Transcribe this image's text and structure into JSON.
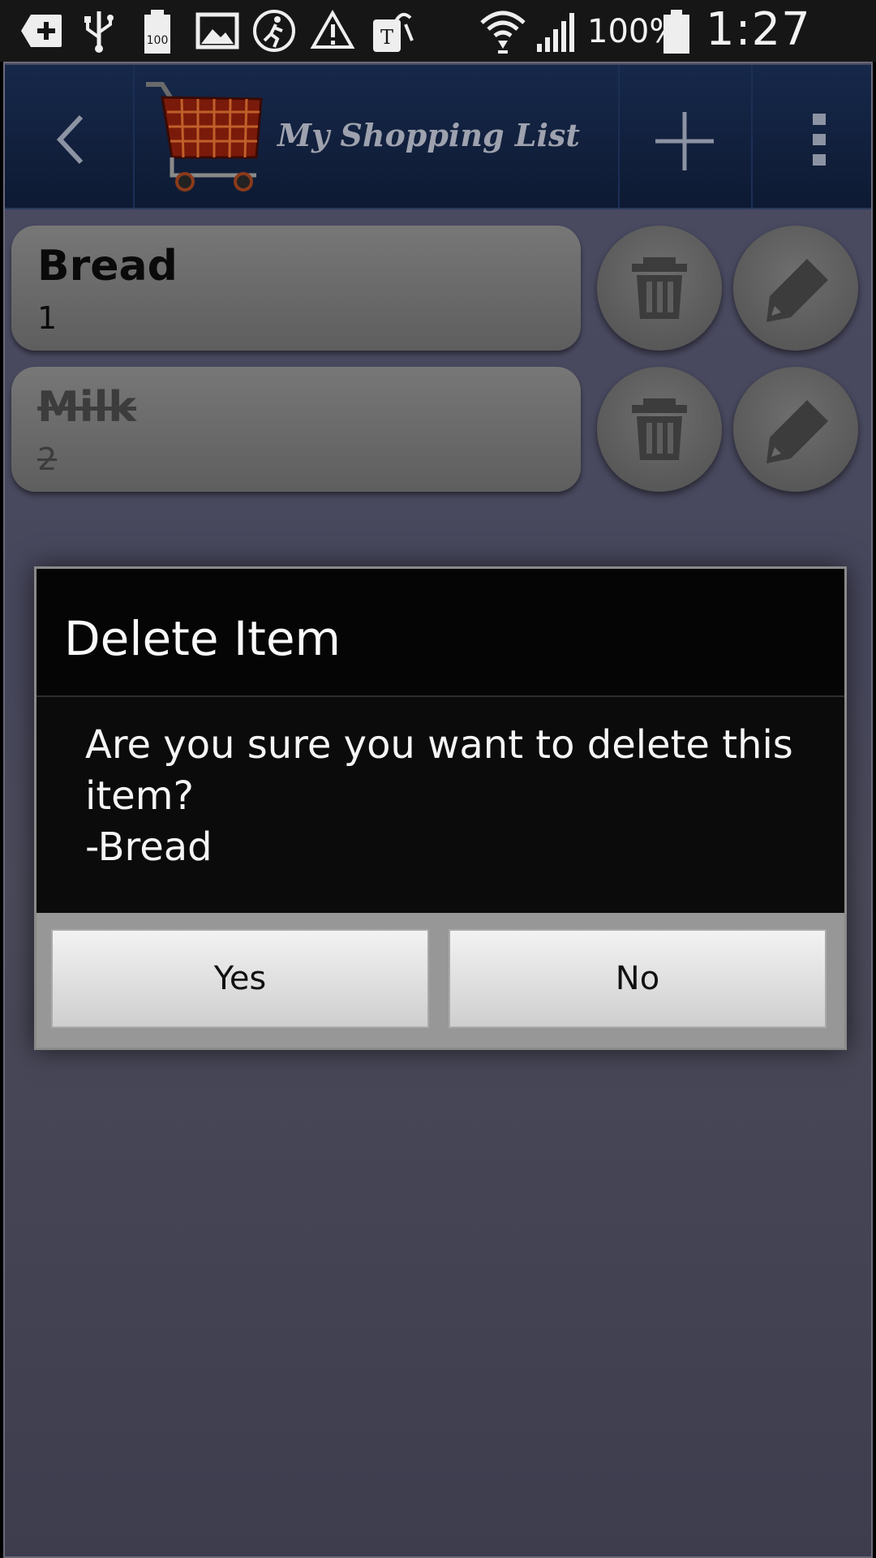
{
  "status_bar": {
    "icons": [
      "add-box-icon",
      "usb-icon",
      "battery-100-icon",
      "image-icon",
      "running-icon",
      "warning-icon",
      "t-mobile-icon",
      "wifi-icon",
      "signal-icon",
      "battery-icon"
    ],
    "battery_text": "100%",
    "time": "1:27 AM"
  },
  "action_bar": {
    "title": "My Shopping List",
    "icons": [
      "back-chevron-icon",
      "shopping-cart-logo",
      "add-icon",
      "overflow-menu-icon"
    ]
  },
  "items": [
    {
      "name": "Bread",
      "qty": "1",
      "crossed": false
    },
    {
      "name": "Milk",
      "qty": "2",
      "crossed": true
    }
  ],
  "dialog": {
    "title": "Delete Item",
    "message_line1": "Are you sure you want to delete this item?",
    "message_line2": "-Bread",
    "yes": "Yes",
    "no": "No"
  },
  "colors": {
    "action_bar": "#16284a",
    "background": "#47475c",
    "dialog": "#0b0b0b"
  }
}
